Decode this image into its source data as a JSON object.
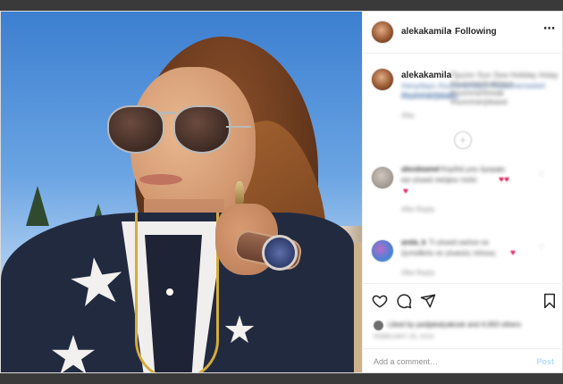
{
  "post": {
    "username": "alekakamila",
    "follow_separator": "•",
    "follow_status": "Following",
    "more_icon": "⋯",
    "caption_text": "Πρώτο Sun Sea Holiday #stay #summerholidays #summerbreak #summerplease",
    "caption_line2": "#anydays #summerdays #summersweet #summerbreak",
    "caption_line3": "#summerplease",
    "caption_time": "49w",
    "load_more_icon": "+"
  },
  "comments": [
    {
      "username": "alexdeamel",
      "text1": "Καρδιά μου όμορφη",
      "text2": "και γλυκιά σκέψου πολύ",
      "hearts": "♥♥",
      "heart_below": "♥",
      "meta": "49w    Reply",
      "like_icon": "♡"
    },
    {
      "username": "arela_k",
      "text1": "Τι γλυκιά εικόνα να",
      "text2": "ζεσταθείτε σε γλυκούς τόπους",
      "hearts": "♥",
      "meta": "49w    Reply",
      "like_icon": "♡"
    }
  ],
  "actions": {
    "likes_text": "Liked by pedjakalyakosk and 4,063 others",
    "date_text": "FEBRUARY 28, 2019",
    "add_comment_placeholder": "Add a comment…",
    "post_label": "Post"
  },
  "colors": {
    "post_disabled": "#b3dbff",
    "heart": "#e0245e"
  }
}
